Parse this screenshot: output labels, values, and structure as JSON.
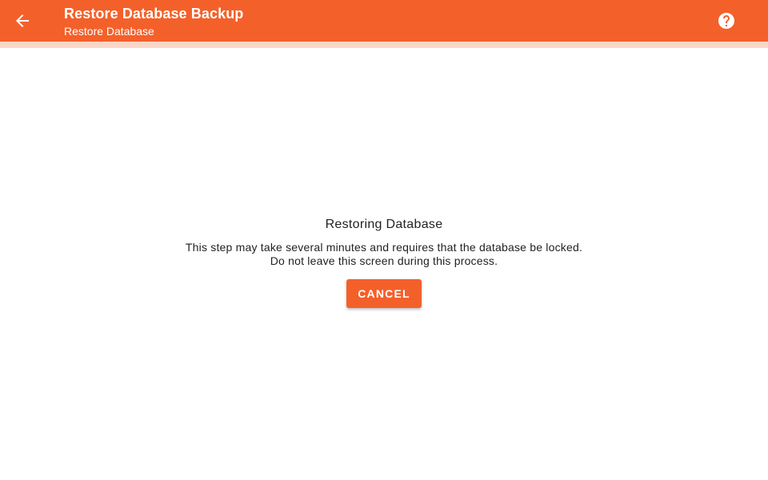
{
  "appbar": {
    "title": "Restore Database Backup",
    "subtitle": "Restore Database",
    "back_icon": "arrow-left-icon",
    "help_icon": "help-circle-icon"
  },
  "progress": {
    "value_percent": 0,
    "indeterminate": true
  },
  "content": {
    "heading": "Restoring Database",
    "description_line1": "This step may take several minutes and requires that the database be locked.",
    "description_line2": "Do not leave this screen during this process.",
    "cancel_label": "CANCEL"
  },
  "colors": {
    "primary": "#f4602a",
    "progress_track": "#fcd6c8",
    "text": "#222222",
    "background": "#ffffff"
  }
}
